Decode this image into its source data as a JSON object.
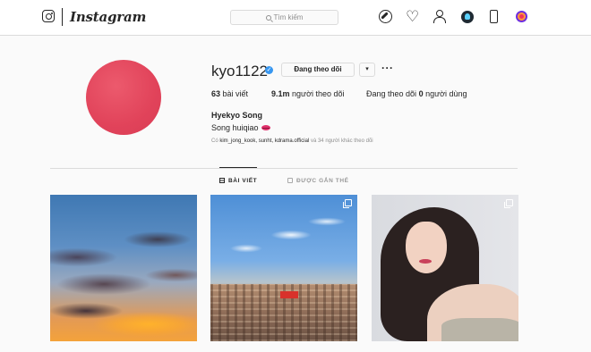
{
  "topbar": {
    "wordmark": "Instagram",
    "search_placeholder": "Tìm kiếm",
    "icons": [
      "instagram-glyph-icon",
      "compass-icon",
      "heart-icon",
      "user-icon",
      "extension-icon",
      "phone-icon",
      "extension-icon"
    ]
  },
  "profile": {
    "username": "kyo1122",
    "verified_mark": "✓",
    "follow_button": "Đang theo dõi",
    "dropdown_glyph": "▾",
    "more_glyph": "···",
    "stats": {
      "posts_count": "63",
      "posts_label": "bài viết",
      "followers_count": "9.1m",
      "followers_label": "người theo dõi",
      "following_prefix": "Đang theo dõi",
      "following_count": "0",
      "following_label": "người dùng"
    },
    "full_name": "Hyekyo Song",
    "bio": "Song huiqiao",
    "followed_by_prefix": "Có",
    "followed_by_names": "kim_jong_kook, sunht, kdrama.official",
    "followed_by_suffix": "và 34 người khác theo dõi"
  },
  "tabs": [
    {
      "label": "BÀI VIẾT",
      "active": true
    },
    {
      "label": "ĐƯỢC GẮN THẺ",
      "active": false
    }
  ],
  "posts": [
    {
      "subject": "sunset sky with clouds",
      "multi": false
    },
    {
      "subject": "city rooftops under blue sky",
      "multi": true
    },
    {
      "subject": "portrait of woman",
      "multi": true
    }
  ],
  "colors": {
    "accent_blue": "#3897f0",
    "border": "#dbdbdb",
    "text": "#262626",
    "muted": "#8e8e8e",
    "avatar": "#e1435a"
  }
}
